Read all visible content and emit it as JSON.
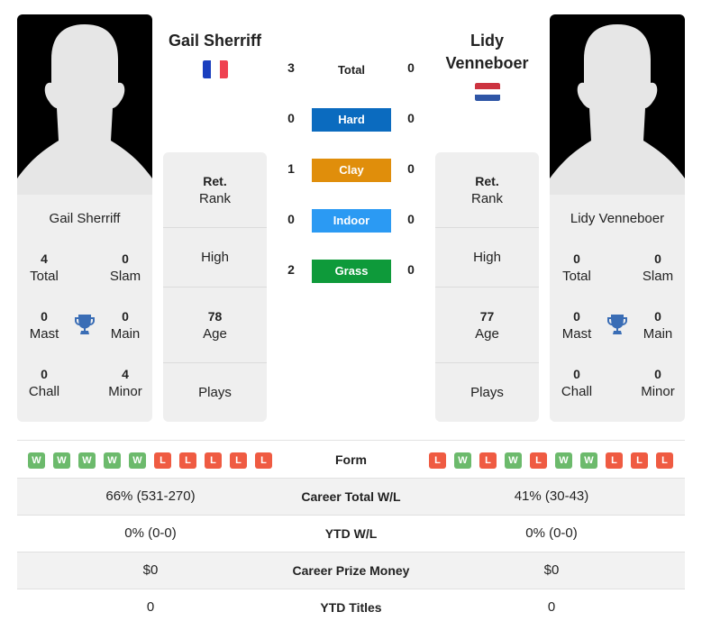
{
  "player1": {
    "name": "Gail Sherriff",
    "card_name": "Gail Sherriff",
    "flag": "France",
    "flag_colors": [
      "#1a3fbf",
      "#ffffff",
      "#ef4151"
    ],
    "titles": {
      "total": {
        "value": "4",
        "label": "Total"
      },
      "slam": {
        "value": "0",
        "label": "Slam"
      },
      "mast": {
        "value": "0",
        "label": "Mast"
      },
      "main": {
        "value": "0",
        "label": "Main"
      },
      "chall": {
        "value": "0",
        "label": "Chall"
      },
      "minor": {
        "value": "4",
        "label": "Minor"
      }
    },
    "rank": {
      "top": "Ret.",
      "bottom": "Rank"
    },
    "high": {
      "label": "High"
    },
    "age": {
      "value": "78",
      "label": "Age"
    },
    "plays": {
      "label": "Plays"
    },
    "form": [
      "W",
      "W",
      "W",
      "W",
      "W",
      "L",
      "L",
      "L",
      "L",
      "L"
    ]
  },
  "player2": {
    "name": "Lidy Venneboer",
    "name_line1": "Lidy",
    "name_line2": "Venneboer",
    "card_name": "Lidy Venneboer",
    "flag": "Netherlands",
    "flag_colors": [
      "#cc3340",
      "#ffffff",
      "#2f56a6"
    ],
    "titles": {
      "total": {
        "value": "0",
        "label": "Total"
      },
      "slam": {
        "value": "0",
        "label": "Slam"
      },
      "mast": {
        "value": "0",
        "label": "Mast"
      },
      "main": {
        "value": "0",
        "label": "Main"
      },
      "chall": {
        "value": "0",
        "label": "Chall"
      },
      "minor": {
        "value": "0",
        "label": "Minor"
      }
    },
    "rank": {
      "top": "Ret.",
      "bottom": "Rank"
    },
    "high": {
      "label": "High"
    },
    "age": {
      "value": "77",
      "label": "Age"
    },
    "plays": {
      "label": "Plays"
    },
    "form": [
      "L",
      "W",
      "L",
      "W",
      "L",
      "W",
      "W",
      "L",
      "L",
      "L"
    ]
  },
  "h2h": {
    "total": {
      "label": "Total",
      "p1": "3",
      "p2": "0"
    },
    "surfaces": [
      {
        "label": "Hard",
        "p1": "0",
        "p2": "0",
        "color": "#0b6bbf"
      },
      {
        "label": "Clay",
        "p1": "1",
        "p2": "0",
        "color": "#e08e0b"
      },
      {
        "label": "Indoor",
        "p1": "0",
        "p2": "0",
        "color": "#2b9af3"
      },
      {
        "label": "Grass",
        "p1": "2",
        "p2": "0",
        "color": "#0e9a3a"
      }
    ]
  },
  "form_label": "Form",
  "comparison": [
    {
      "label": "Career Total W/L",
      "p1": "66% (531-270)",
      "p2": "41% (30-43)"
    },
    {
      "label": "YTD W/L",
      "p1": "0% (0-0)",
      "p2": "0% (0-0)"
    },
    {
      "label": "Career Prize Money",
      "p1": "$0",
      "p2": "$0"
    },
    {
      "label": "YTD Titles",
      "p1": "0",
      "p2": "0"
    }
  ],
  "icons": {
    "trophy": "trophy-icon",
    "photo": "player-silhouette-icon"
  }
}
